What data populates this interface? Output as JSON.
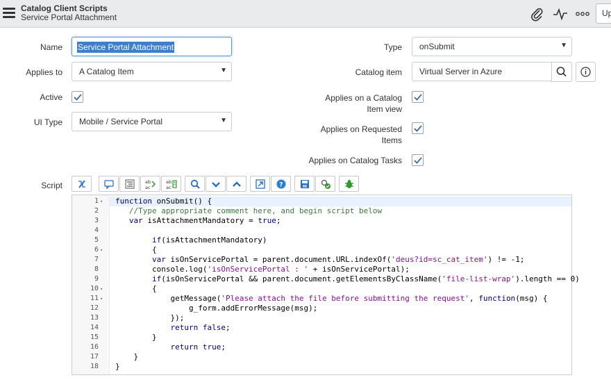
{
  "header": {
    "title": "Catalog Client Scripts",
    "subtitle": "Service Portal Attachment",
    "update_button": "Up",
    "icons": [
      "paperclip-icon",
      "activity-icon",
      "more-icon"
    ]
  },
  "form": {
    "name_label": "Name",
    "name_value": "Service Portal Attachment",
    "applies_to_label": "Applies to",
    "applies_to_value": "A Catalog Item",
    "active_label": "Active",
    "active_checked": true,
    "ui_type_label": "UI Type",
    "ui_type_value": "Mobile / Service Portal",
    "type_label": "Type",
    "type_value": "onSubmit",
    "catalog_item_label": "Catalog item",
    "catalog_item_value": "Virtual Server in Azure",
    "applies_catalog_view_label_1": "Applies on a Catalog",
    "applies_catalog_view_label_2": "Item view",
    "applies_catalog_view_checked": true,
    "applies_requested_label_1": "Applies on Requested",
    "applies_requested_label_2": "Items",
    "applies_requested_checked": true,
    "applies_tasks_label": "Applies on Catalog Tasks",
    "applies_tasks_checked": true,
    "script_label": "Script"
  },
  "toolbar": {
    "buttons": [
      "toggle-syntax-icon",
      "comment-icon",
      "format-icon",
      "replace-icon",
      "replace-all-icon",
      "search-icon",
      "next-icon",
      "previous-icon",
      "fullscreen-icon",
      "help-icon",
      "save-icon",
      "script-check-icon",
      "debug-icon"
    ]
  },
  "editor": {
    "lines": [
      {
        "n": "1",
        "fold": "▾",
        "text": "function onSubmit() {"
      },
      {
        "n": "2",
        "fold": "",
        "text": "   //Type appropriate comment here, and begin script below"
      },
      {
        "n": "3",
        "fold": "",
        "text": "   var isAttachmentMandatory = true;"
      },
      {
        "n": "4",
        "fold": "",
        "text": ""
      },
      {
        "n": "5",
        "fold": "",
        "text": "        if(isAttachmentMandatory)"
      },
      {
        "n": "6",
        "fold": "▾",
        "text": "        {"
      },
      {
        "n": "7",
        "fold": "",
        "text": "        var isOnServicePortal = parent.document.URL.indexOf('deus?id=sc_cat_item') != -1;"
      },
      {
        "n": "8",
        "fold": "",
        "text": "        console.log('isOnServicePortal : ' + isOnServicePortal);"
      },
      {
        "n": "9",
        "fold": "",
        "text": "        if(isOnServicePortal && parent.document.getElementsByClassName('file-list-wrap').length == 0)"
      },
      {
        "n": "10",
        "fold": "▾",
        "text": "        {"
      },
      {
        "n": "11",
        "fold": "▾",
        "text": "            getMessage('Please attach the file before submitting the request', function(msg) {"
      },
      {
        "n": "12",
        "fold": "",
        "text": "                g_form.addErrorMessage(msg);"
      },
      {
        "n": "13",
        "fold": "",
        "text": "            });"
      },
      {
        "n": "14",
        "fold": "",
        "text": "            return false;"
      },
      {
        "n": "15",
        "fold": "",
        "text": "        }"
      },
      {
        "n": "16",
        "fold": "",
        "text": "            return true;"
      },
      {
        "n": "17",
        "fold": "",
        "text": "    }"
      },
      {
        "n": "18",
        "fold": "",
        "text": "}"
      }
    ]
  },
  "colors": {
    "header_bg": "#e9ebec",
    "selection": "#3d7ecf",
    "focus_border": "#5a9bd4",
    "check": "#3a6ea8"
  }
}
